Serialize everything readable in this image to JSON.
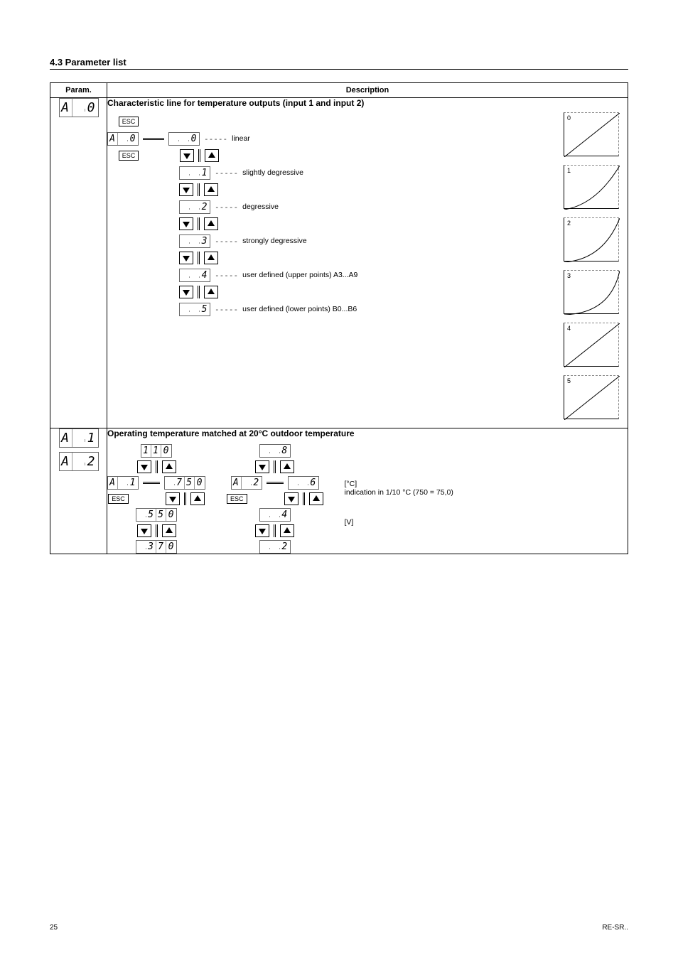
{
  "page": {
    "title": "4.3 Parameter list",
    "footer_left": "25",
    "footer_right": "RE-SR.."
  },
  "headers": {
    "param": "Param.",
    "desc": "Description"
  },
  "row_a0": {
    "lcd_big": [
      "A",
      "",
      "0"
    ],
    "title": "Characteristic line for temperature outputs (input 1 and input 2)",
    "lcd_small": [
      "A",
      "",
      "0"
    ],
    "esc": "ESC",
    "steps": [
      {
        "val": [
          "",
          "",
          "0"
        ],
        "desc": "linear"
      },
      {
        "val": [
          "",
          "",
          "1"
        ],
        "desc": "slightly degressive"
      },
      {
        "val": [
          "",
          "",
          "2"
        ],
        "desc": "degressive"
      },
      {
        "val": [
          "",
          "",
          "3"
        ],
        "desc": "strongly degressive"
      },
      {
        "val": [
          "",
          "",
          "4"
        ],
        "desc": "user defined (upper points) A3...A9"
      },
      {
        "val": [
          "",
          "",
          "5"
        ],
        "desc": "user defined (lower points) B0...B6"
      }
    ],
    "curves": [
      "0",
      "1",
      "2",
      "3",
      "4",
      "5"
    ]
  },
  "row_a12": {
    "lcd1": [
      "A",
      "",
      "1"
    ],
    "lcd2": [
      "A",
      "",
      "2"
    ],
    "title": "Operating temperature matched at 20°C outdoor temperature",
    "esc": "ESC",
    "colA": {
      "lcd_small": [
        "A",
        "",
        "1"
      ],
      "options": [
        [
          "1",
          "1",
          "0"
        ],
        [
          "",
          "7",
          "5",
          "0"
        ],
        [
          "",
          "5",
          "5",
          "0"
        ],
        [
          "",
          "3",
          "7",
          "0"
        ]
      ],
      "active": 1,
      "unit": "[°C]",
      "note": "indication in 1/10 °C (750 = 75,0)"
    },
    "colB": {
      "lcd_small": [
        "A",
        "",
        "2"
      ],
      "options": [
        [
          "",
          "",
          "8"
        ],
        [
          "",
          "",
          "6"
        ],
        [
          "",
          "",
          "4"
        ],
        [
          "",
          "",
          "2"
        ]
      ],
      "active": 1,
      "unit": "[V]"
    }
  }
}
